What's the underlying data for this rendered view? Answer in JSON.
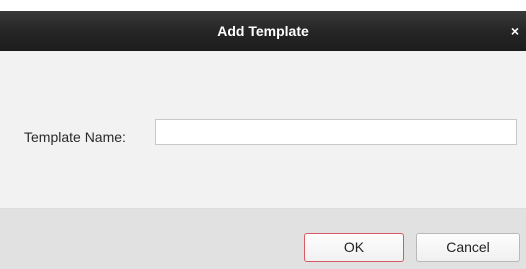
{
  "dialog": {
    "title": "Add Template",
    "close_glyph": "×"
  },
  "form": {
    "template_name_label": "Template Name:",
    "template_name_value": "",
    "template_name_placeholder": ""
  },
  "buttons": {
    "ok_label": "OK",
    "cancel_label": "Cancel"
  },
  "colors": {
    "titlebar_bg": "#262626",
    "ok_border": "#d75a64"
  }
}
